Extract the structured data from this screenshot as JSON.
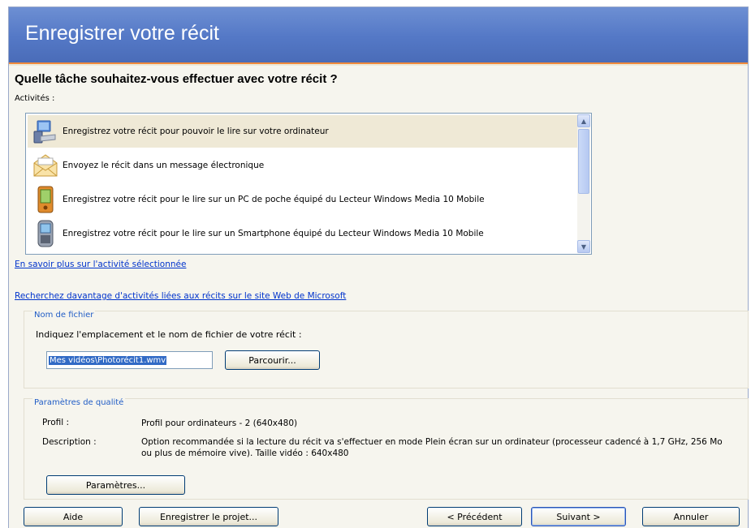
{
  "window": {
    "title": "Enregistrer votre récit"
  },
  "question": "Quelle tâche souhaitez-vous effectuer avec votre récit ?",
  "activities": {
    "label": "Activités :",
    "items": [
      {
        "label": "Enregistrez votre récit pour pouvoir le lire sur votre ordinateur",
        "icon": "computer-icon",
        "selected": true
      },
      {
        "label": "Envoyez le récit dans un message électronique",
        "icon": "envelope-icon",
        "selected": false
      },
      {
        "label": "Enregistrez votre récit pour le lire sur un PC de poche équipé du Lecteur Windows Media 10 Mobile",
        "icon": "pocket-pc-icon",
        "selected": false
      },
      {
        "label": "Enregistrez votre récit pour le lire sur un Smartphone équipé du Lecteur Windows Media 10 Mobile",
        "icon": "smartphone-icon",
        "selected": false
      }
    ]
  },
  "links": {
    "learn_more": "En savoir plus sur l'activité sélectionnée",
    "search_more": "Recherchez davantage d'activités liées aux récits sur le site Web de Microsoft"
  },
  "filename": {
    "group_title": "Nom de fichier",
    "instruction": "Indiquez l'emplacement et le nom de fichier de votre récit :",
    "value": "Mes vidéos\\Photorécit1.wmv",
    "browse_label": "Parcourir..."
  },
  "quality": {
    "group_title": "Paramètres de qualité",
    "profile_key": "Profil :",
    "profile_value": "Profil pour ordinateurs - 2 (640x480)",
    "description_key": "Description :",
    "description_value": "Option recommandée si la lecture du récit va s'effectuer en mode Plein écran sur un ordinateur (processeur cadencé à 1,7 GHz, 256 Mo ou plus de mémoire vive). Taille vidéo : 640x480",
    "settings_label": "Paramètres..."
  },
  "footer": {
    "help": "Aide",
    "save_project": "Enregistrer le projet...",
    "previous": "< Précédent",
    "next": "Suivant >",
    "cancel": "Annuler"
  },
  "colors": {
    "title_bar": "#5478c6",
    "accent_line": "#f08a3c",
    "link": "#0033cc",
    "selection": "#316ac5"
  }
}
